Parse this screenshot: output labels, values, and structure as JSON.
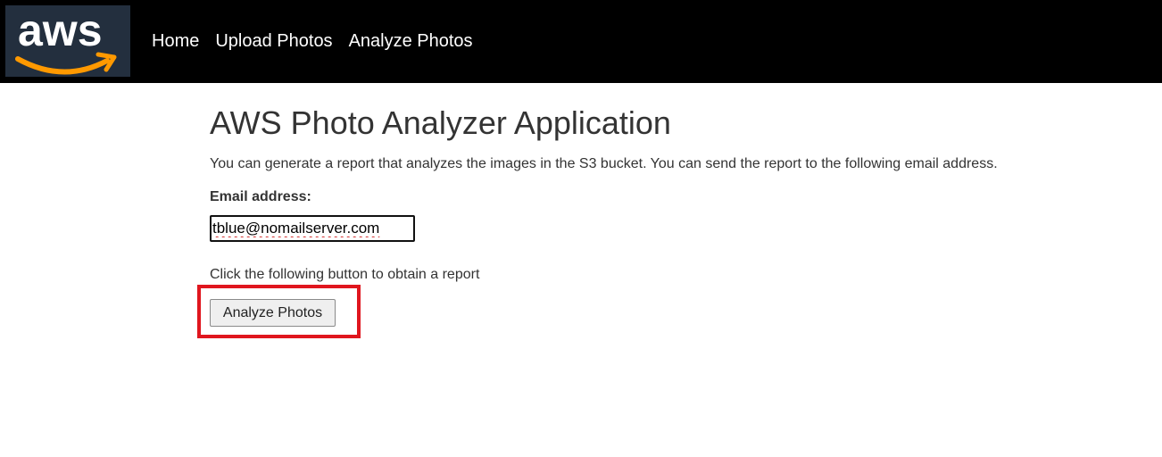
{
  "header": {
    "logo_text": "aws",
    "nav": [
      {
        "label": "Home"
      },
      {
        "label": "Upload Photos"
      },
      {
        "label": "Analyze Photos"
      }
    ]
  },
  "main": {
    "title": "AWS Photo Analyzer Application",
    "description": "You can generate a report that analyzes the images in the S3 bucket. You can send the report to the following email address.",
    "email_label": "Email address:",
    "email_value": "tblue@nomailserver.com",
    "prompt": "Click the following button to obtain a report",
    "button_label": "Analyze Photos"
  },
  "colors": {
    "topbar": "#000000",
    "logo_bg": "#232f3e",
    "logo_smile": "#ff9900",
    "highlight": "#e0161e"
  }
}
